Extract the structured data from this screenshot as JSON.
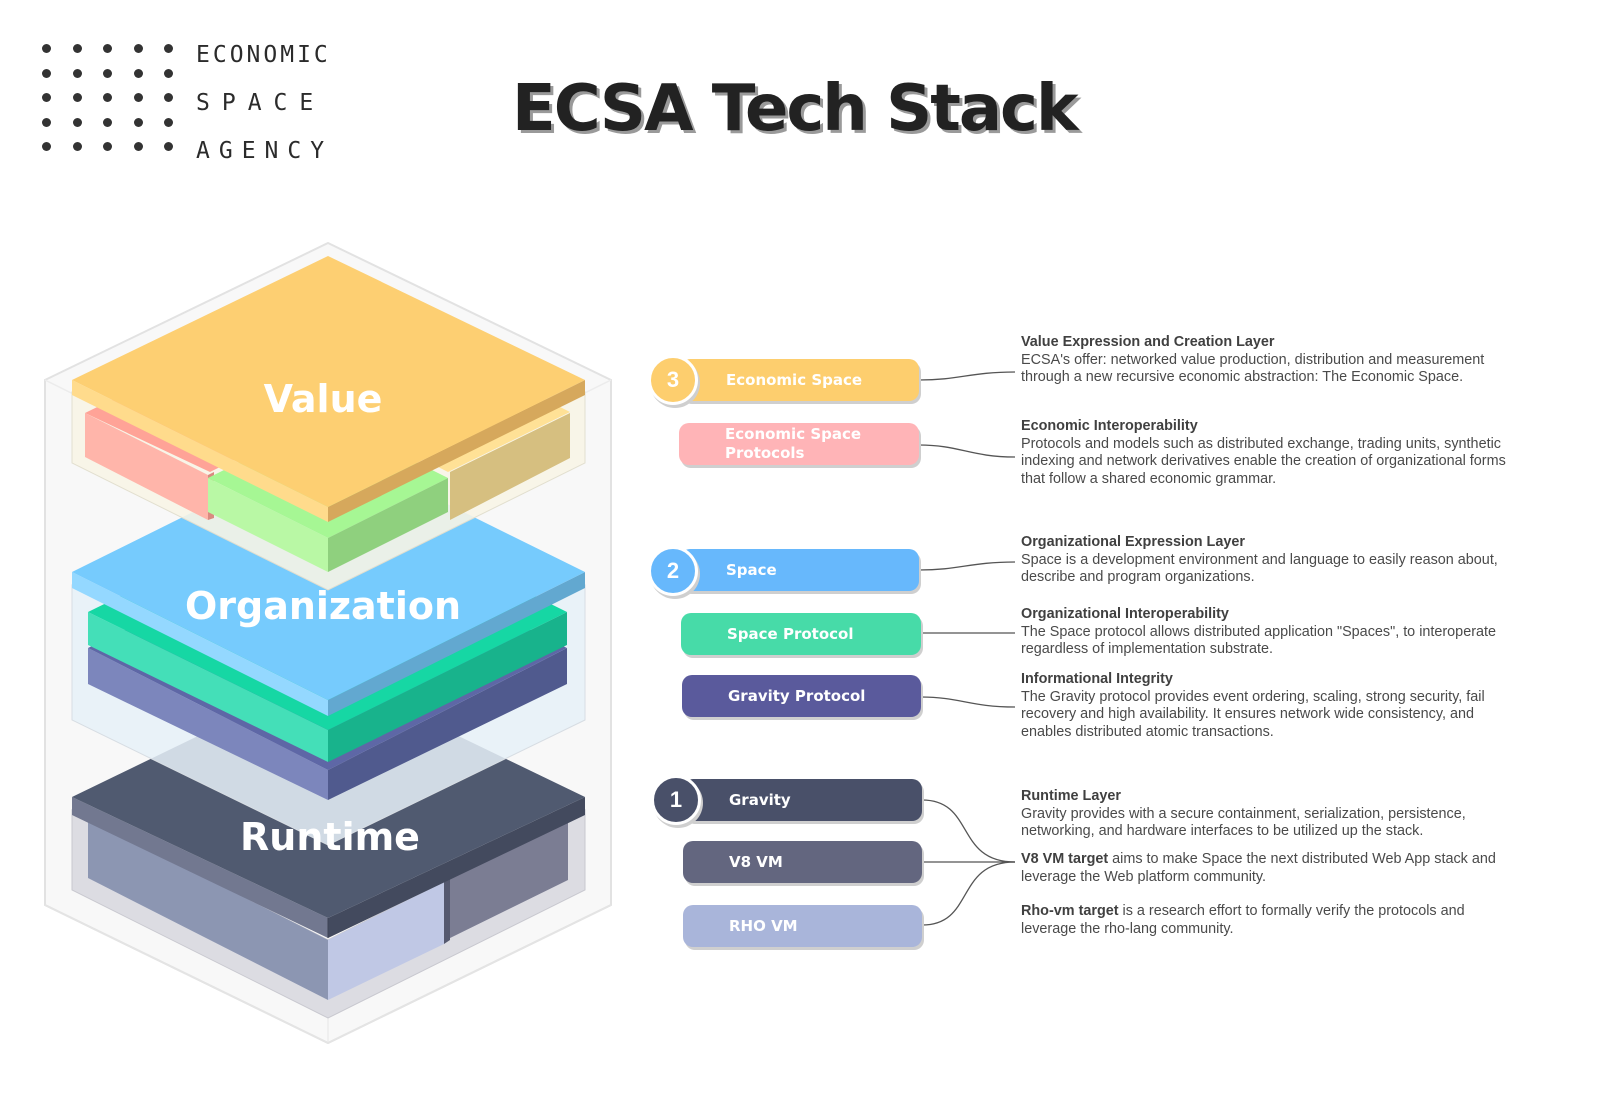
{
  "logo": {
    "lines": [
      "ECONOMIC",
      "SPACE",
      "AGENCY"
    ],
    "icon": "dot-grid-icon"
  },
  "title": "ECSA Tech Stack",
  "stack": {
    "layers": [
      {
        "label": "Value",
        "top_color": "#FDCF72",
        "side_left": "#FFDB8C",
        "side_right": "#D6A85C"
      },
      {
        "label": "Organization",
        "top_color": "#76CBFD",
        "side_left": "#94D8FF",
        "side_right": "#62A8D0"
      },
      {
        "label": "Runtime",
        "top_color": "#505A70",
        "side_left": "#727890",
        "side_right": "#434A5E"
      }
    ],
    "blocks": {
      "value_left": "#FFB5AA",
      "value_middle": "#B9F8A5",
      "value_right": "#D6BF80",
      "space_protocol": "#44DFB8",
      "gravity_protocol": "#7C86BC",
      "runtime_left": "#8C96B2",
      "runtime_middle": "#C0C8E5",
      "runtime_right": "#7B7D93"
    }
  },
  "sections": [
    {
      "number": "3",
      "items": [
        {
          "label": "Economic Space",
          "color": "#FDCE6E",
          "heading": "Value Expression and Creation Layer",
          "text": "ECSA's offer: networked value production, distribution and measurement through a new recursive economic abstraction: The Economic Space."
        },
        {
          "label": "Economic Space Protocols",
          "color": "#FFB4B7",
          "heading": "Economic Interoperability",
          "text": "Protocols and models such as distributed exchange, trading units, synthetic indexing and network derivatives enable the creation of organizational forms that follow a shared economic grammar."
        }
      ]
    },
    {
      "number": "2",
      "items": [
        {
          "label": "Space",
          "color": "#67B8FC",
          "heading": "Organizational Expression Layer",
          "text": "Space is a development environment and language to easily reason about, describe and program organizations."
        },
        {
          "label": "Space Protocol",
          "color": "#47DBA8",
          "heading": "Organizational Interoperability",
          "text": "The Space protocol allows distributed application \"Spaces\", to interoperate regardless of implementation substrate."
        },
        {
          "label": "Gravity Protocol",
          "color": "#5A5A9C",
          "heading": "Informational Integrity",
          "text": "The Gravity protocol provides event ordering, scaling, strong security, fail recovery and high availability. It ensures network wide consistency, and enables distributed atomic transactions."
        }
      ]
    },
    {
      "number": "1",
      "items": [
        {
          "label": "Gravity",
          "color": "#495069",
          "heading": "Runtime Layer",
          "text": "Gravity provides with a secure containment, serialization, persistence, networking, and hardware interfaces to be utilized up the stack."
        },
        {
          "label": "V8 VM",
          "color": "#63667F",
          "lead": "V8 VM target",
          "text": " aims to make Space the next distributed Web App stack and leverage the Web platform community."
        },
        {
          "label": "RHO VM",
          "color": "#A9B5DA",
          "lead": "Rho-vm target",
          "text": " is a research effort to formally verify the protocols and leverage the rho-lang community."
        }
      ]
    }
  ]
}
